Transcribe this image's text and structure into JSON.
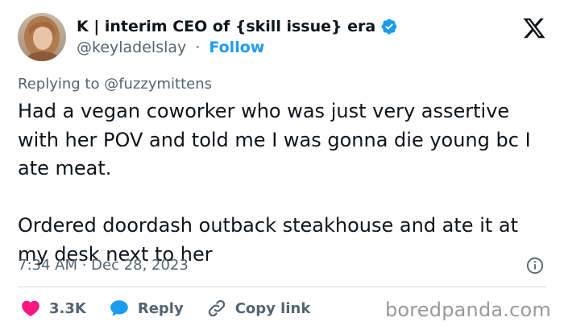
{
  "tweet": {
    "display_name": "K | interim CEO of {skill issue} era",
    "handle": "@keyladelslay",
    "separator": "·",
    "follow_label": "Follow",
    "replying_to": "Replying to @fuzzymittens",
    "body": "Had a vegan coworker who was just very assertive with her POV and told me I was gonna die young bc I ate meat.\n\nOrdered doordash outback steakhouse and ate it at my desk next to her",
    "timestamp": "7:34 AM · Dec 28, 2023"
  },
  "actions": {
    "likes": "3.3K",
    "reply_label": "Reply",
    "copy_link_label": "Copy link"
  },
  "watermark": "boredpanda.com",
  "colors": {
    "accent": "#1d9bf0",
    "like": "#f91880",
    "secondary_text": "#536471",
    "verified": "#1d9bf0"
  },
  "icons": [
    "verified-badge-icon",
    "x-logo-icon",
    "info-icon",
    "heart-icon",
    "reply-bubble-icon",
    "link-icon"
  ]
}
